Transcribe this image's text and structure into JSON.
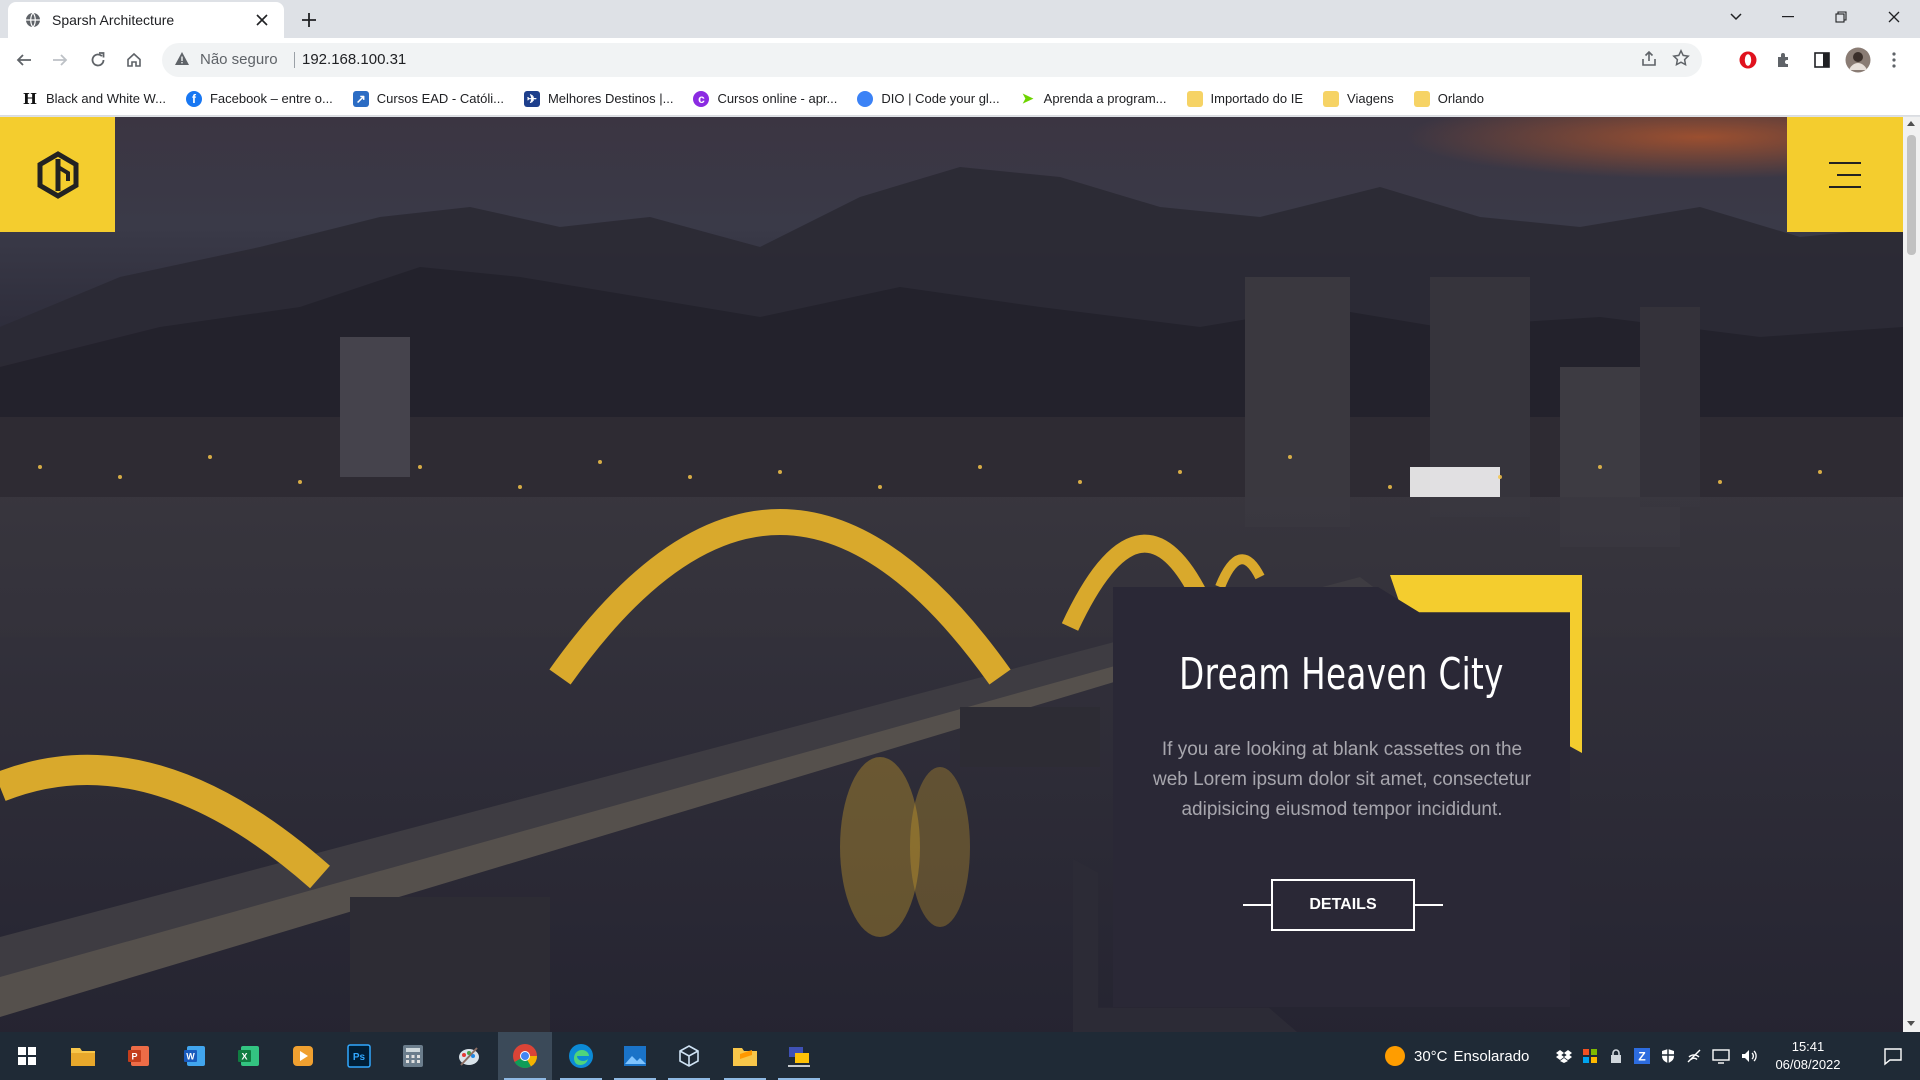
{
  "browser": {
    "tab_title": "Sparsh Architecture",
    "security_label": "Não seguro",
    "url": "192.168.100.31",
    "bookmarks": [
      {
        "label": "Black and White W...",
        "icon": "h-icon"
      },
      {
        "label": "Facebook – entre o...",
        "icon": "facebook-icon"
      },
      {
        "label": "Cursos EAD - Católi...",
        "icon": "cursos-icon"
      },
      {
        "label": "Melhores Destinos |...",
        "icon": "melhores-destinos-icon"
      },
      {
        "label": "Cursos online - apr...",
        "icon": "cursos-online-icon"
      },
      {
        "label": "DIO | Code your gl...",
        "icon": "dio-icon"
      },
      {
        "label": "Aprenda a program...",
        "icon": "aprenda-icon"
      },
      {
        "label": "Importado do IE",
        "icon": "folder-icon"
      },
      {
        "label": "Viagens",
        "icon": "folder-icon"
      },
      {
        "label": "Orlando",
        "icon": "folder-icon"
      }
    ]
  },
  "page": {
    "card_title": "Dream Heaven City",
    "card_text": "If you are looking at blank cassettes on the web Lorem ipsum dolor sit amet, consectetur adipisicing eiusmod tempor incididunt.",
    "details_label": "DETAILS",
    "accent_color": "#f4cd2e",
    "card_color": "#2a2836"
  },
  "taskbar": {
    "weather_temp": "30°C",
    "weather_desc": "Ensolarado",
    "time": "15:41",
    "date": "06/08/2022"
  }
}
